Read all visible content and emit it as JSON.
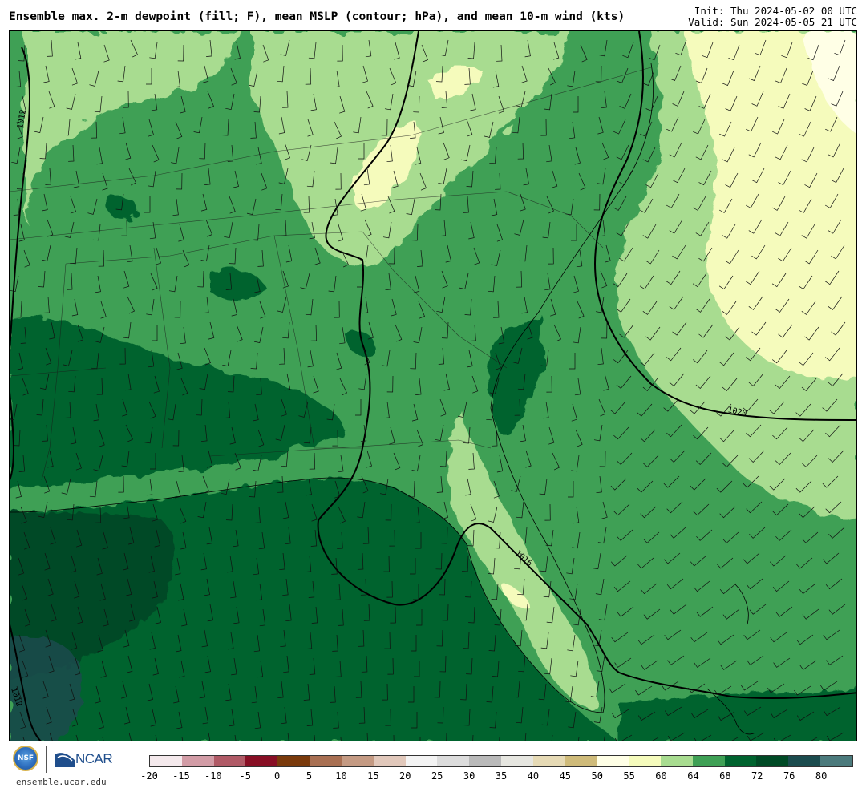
{
  "header": {
    "title": "Ensemble max. 2-m dewpoint (fill; F), mean MSLP (contour; hPa), and mean 10-m wind (kts)",
    "init": "Init: Thu 2024-05-02 00 UTC",
    "valid": "Valid: Sun 2024-05-05 21 UTC"
  },
  "map": {
    "isobar_labels": [
      "1012",
      "1016",
      "1020",
      "1012"
    ],
    "colors": {
      "ocean_deep": "#00632f",
      "dark_green": "#004a26",
      "green": "#3fa055",
      "light_green": "#a8dc90",
      "pale_yellow": "#f5fbbc",
      "very_pale": "#ffffe6",
      "contour": "#000000"
    }
  },
  "colorbar": {
    "ticks": [
      "-20",
      "-15",
      "-10",
      "-5",
      "0",
      "5",
      "10",
      "15",
      "20",
      "25",
      "30",
      "35",
      "40",
      "45",
      "50",
      "55",
      "60",
      "64",
      "68",
      "72",
      "76",
      "80"
    ],
    "colors": [
      "#f4e9ec",
      "#d29ca6",
      "#b05a66",
      "#880f25",
      "#7a3a0c",
      "#a86f52",
      "#c49a83",
      "#e1c8bb",
      "#f3f3f3",
      "#dcdcdc",
      "#b9b9b9",
      "#e6e6e0",
      "#e6dab5",
      "#cfbb7a",
      "#ffffe6",
      "#f5fbbc",
      "#a8dc90",
      "#3fa055",
      "#00632f",
      "#004a26",
      "#1b4c4e",
      "#4b7a7c"
    ]
  },
  "footer": {
    "nsf_label": "NSF",
    "ncar_label": "NCAR",
    "site": "ensemble.ucar.edu"
  }
}
